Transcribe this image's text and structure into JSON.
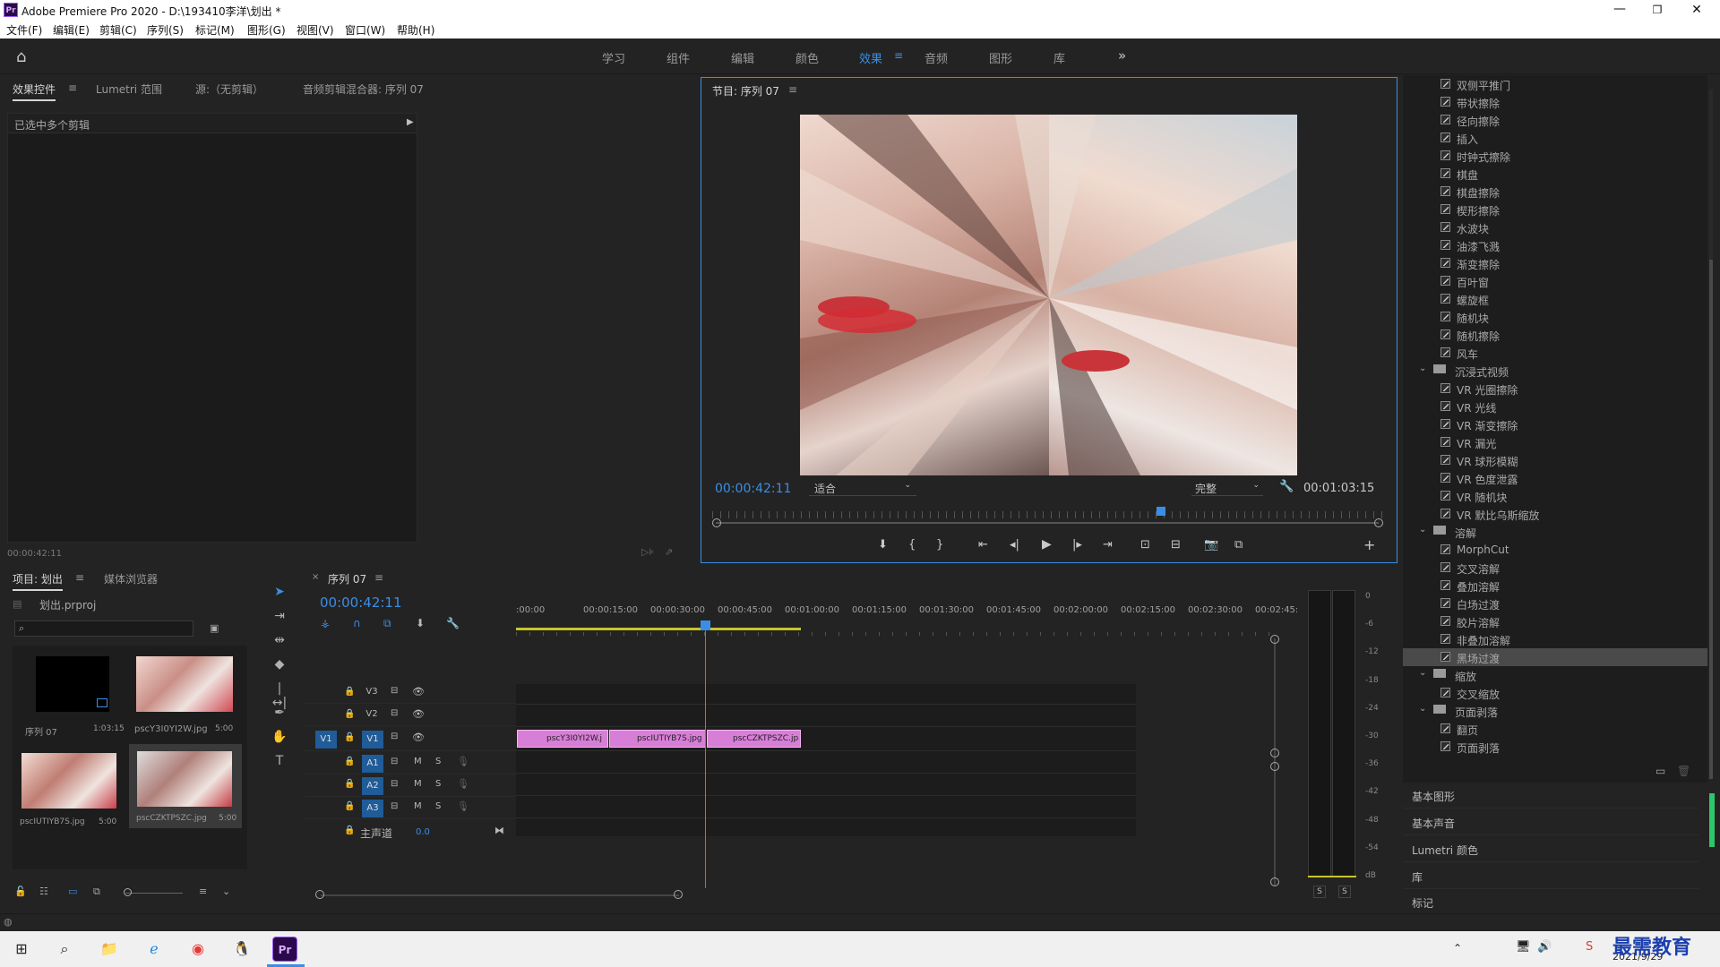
{
  "app": {
    "title": "Adobe Premiere Pro 2020 - D:\\193410李洋\\划出 *",
    "logo": "Pr"
  },
  "menu": [
    "文件(F)",
    "编辑(E)",
    "剪辑(C)",
    "序列(S)",
    "标记(M)",
    "图形(G)",
    "视图(V)",
    "窗口(W)",
    "帮助(H)"
  ],
  "workspaces": [
    "学习",
    "组件",
    "编辑",
    "颜色",
    "效果",
    "音频",
    "图形",
    "库"
  ],
  "active_workspace": "效果",
  "source_panel": {
    "tabs": [
      "效果控件",
      "Lumetri 范围",
      "源:（无剪辑）",
      "音频剪辑混合器: 序列 07"
    ],
    "header": "已选中多个剪辑",
    "timecode": "00:00:42:11"
  },
  "program_monitor": {
    "title": "节目: 序列 07",
    "timecode_current": "00:00:42:11",
    "timecode_end": "00:01:03:15",
    "fit": "适合",
    "quality": "完整"
  },
  "effects_list": [
    {
      "type": "item",
      "label": "双侧平推门"
    },
    {
      "type": "item",
      "label": "带状擦除"
    },
    {
      "type": "item",
      "label": "径向擦除"
    },
    {
      "type": "item",
      "label": "插入"
    },
    {
      "type": "item",
      "label": "时钟式擦除"
    },
    {
      "type": "item",
      "label": "棋盘"
    },
    {
      "type": "item",
      "label": "棋盘擦除"
    },
    {
      "type": "item",
      "label": "楔形擦除"
    },
    {
      "type": "item",
      "label": "水波块"
    },
    {
      "type": "item",
      "label": "油漆飞溅"
    },
    {
      "type": "item",
      "label": "渐变擦除"
    },
    {
      "type": "item",
      "label": "百叶窗"
    },
    {
      "type": "item",
      "label": "螺旋框"
    },
    {
      "type": "item",
      "label": "随机块"
    },
    {
      "type": "item",
      "label": "随机擦除"
    },
    {
      "type": "item",
      "label": "风车"
    },
    {
      "type": "folder",
      "label": "沉浸式视频"
    },
    {
      "type": "item",
      "label": "VR 光圈擦除"
    },
    {
      "type": "item",
      "label": "VR 光线"
    },
    {
      "type": "item",
      "label": "VR 渐变擦除"
    },
    {
      "type": "item",
      "label": "VR 漏光"
    },
    {
      "type": "item",
      "label": "VR 球形模糊"
    },
    {
      "type": "item",
      "label": "VR 色度泄露"
    },
    {
      "type": "item",
      "label": "VR 随机块"
    },
    {
      "type": "item",
      "label": "VR 默比乌斯缩放"
    },
    {
      "type": "folder",
      "label": "溶解"
    },
    {
      "type": "item",
      "label": "MorphCut"
    },
    {
      "type": "item",
      "label": "交叉溶解"
    },
    {
      "type": "item",
      "label": "叠加溶解"
    },
    {
      "type": "item",
      "label": "白场过渡"
    },
    {
      "type": "item",
      "label": "胶片溶解"
    },
    {
      "type": "item",
      "label": "非叠加溶解"
    },
    {
      "type": "item",
      "label": "黑场过渡",
      "selected": true
    },
    {
      "type": "folder",
      "label": "缩放"
    },
    {
      "type": "item",
      "label": "交叉缩放"
    },
    {
      "type": "folder",
      "label": "页面剥落"
    },
    {
      "type": "item",
      "label": "翻页"
    },
    {
      "type": "item",
      "label": "页面剥落"
    }
  ],
  "right_sections": [
    "基本图形",
    "基本声音",
    "Lumetri 颜色",
    "库",
    "标记"
  ],
  "project_panel": {
    "tabs": [
      "项目: 划出",
      "媒体浏览器"
    ],
    "project_file": "划出.prproj",
    "items": [
      {
        "name": "序列 07",
        "duration": "1:03:15"
      },
      {
        "name": "pscY3I0YI2W.jpg",
        "duration": "5:00"
      },
      {
        "name": "pscIUTIYB7S.jpg",
        "duration": "5:00"
      },
      {
        "name": "pscCZKTPSZC.jpg",
        "duration": "5:00"
      }
    ]
  },
  "timeline": {
    "tab": "序列 07",
    "timecode": "00:00:42:11",
    "ruler": [
      ":00:00",
      "00:00:15:00",
      "00:00:30:00",
      "00:00:45:00",
      "00:01:00:00",
      "00:01:15:00",
      "00:01:30:00",
      "00:01:45:00",
      "00:02:00:00",
      "00:02:15:00",
      "00:02:30:00",
      "00:02:45:"
    ],
    "video_tracks": [
      "V3",
      "V2",
      "V1"
    ],
    "audio_tracks": [
      "A1",
      "A2",
      "A3"
    ],
    "source_patch": "V1",
    "master_label": "主声道",
    "master_value": "0.0",
    "mute": "M",
    "solo": "S",
    "clips": [
      {
        "label": "pscY3I0YI2W.j"
      },
      {
        "label": "pscIUTIYB7S.jpg"
      },
      {
        "label": "pscCZKTPSZC.jp"
      }
    ]
  },
  "audio_meter": {
    "scale": [
      "0",
      "-6",
      "-12",
      "-18",
      "-24",
      "-30",
      "-36",
      "-42",
      "-48",
      "-54",
      "dB"
    ],
    "solo_labels": [
      "S",
      "S"
    ]
  },
  "taskbar": {
    "date": "2021/9/29",
    "watermark": "最需教育"
  }
}
